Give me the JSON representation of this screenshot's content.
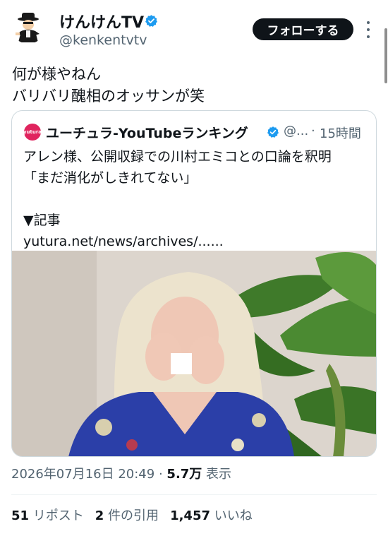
{
  "user": {
    "display_name": "けんけんTV",
    "handle": "@kenkentvtv",
    "follow_label": "フォローする"
  },
  "tweet": {
    "line1": "何が様やねん",
    "line2": "バリバリ醜相のオッサンが笑"
  },
  "quote": {
    "avatar_text": "yutura",
    "name": "ユーチュラ-YouTubeランキング",
    "handle": "@...",
    "separator": "·",
    "time": "15時間",
    "body": "アレン様、公開収録での川村エミコとの口論を釈明\n「まだ消化がしきれてない」\n\n▼記事\nyutura.net/news/archives/......"
  },
  "meta": {
    "datetime": "2026年07月16日 20:49",
    "separator": "·",
    "views": "5.7万",
    "views_label": "表示"
  },
  "stats": {
    "reposts": "51",
    "reposts_label": "リポスト",
    "quotes": "2",
    "quotes_label": "件の引用",
    "likes": "1,457",
    "likes_label": "いいね"
  },
  "icons": {
    "verified": "verified-badge-icon",
    "more": "more-options-icon"
  },
  "colors": {
    "verified_blue": "#1d9bf0",
    "follow_bg": "#0f1419",
    "secondary_text": "#536471",
    "border": "#cfd9de"
  }
}
